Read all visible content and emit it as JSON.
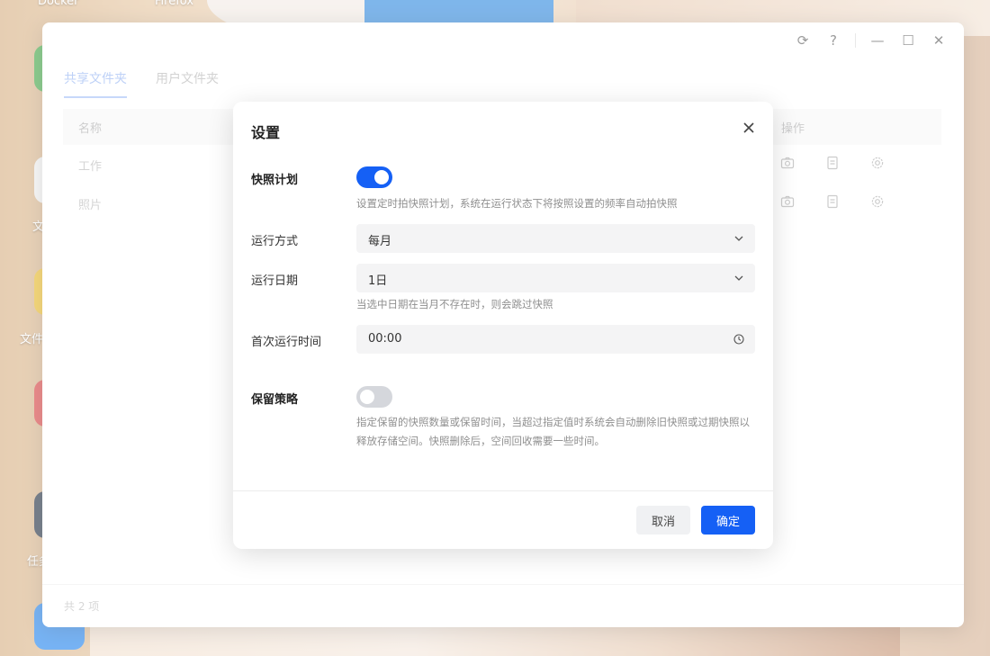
{
  "desktop": {
    "labels": [
      "Docker",
      "Firefox",
      "文",
      "文件",
      "任务"
    ]
  },
  "window": {
    "titlebar": {
      "refresh_glyph": "⟳",
      "help_glyph": "?",
      "minimize_glyph": "—",
      "maximize_glyph": "☐",
      "close_glyph": "✕"
    },
    "tabs": [
      {
        "label": "共享文件夹",
        "active": true
      },
      {
        "label": "用户文件夹",
        "active": false
      }
    ],
    "table": {
      "columns": [
        "名称",
        "操作"
      ],
      "rows": [
        {
          "name": "工作",
          "actions": [
            "camera-icon",
            "doc-icon",
            "gear-icon"
          ]
        },
        {
          "name": "照片",
          "actions": [
            "camera-icon",
            "doc-icon",
            "gear-icon"
          ]
        }
      ]
    },
    "footer": {
      "count_text": "共 2 项"
    }
  },
  "dialog": {
    "title": "设置",
    "snapshot_plan": {
      "label": "快照计划",
      "enabled": true,
      "hint": "设置定时拍快照计划，系统在运行状态下将按照设置的频率自动拍快照"
    },
    "run_mode": {
      "label": "运行方式",
      "value": "每月"
    },
    "run_date": {
      "label": "运行日期",
      "value": "1日",
      "hint": "当选中日期在当月不存在时，则会跳过快照"
    },
    "first_run_time": {
      "label": "首次运行时间",
      "value": "00:00"
    },
    "retention": {
      "label": "保留策略",
      "enabled": false,
      "hint": "指定保留的快照数量或保留时间，当超过指定值时系统会自动删除旧快照或过期快照以释放存储空间。快照删除后，空间回收需要一些时间。"
    },
    "buttons": {
      "cancel": "取消",
      "ok": "确定"
    }
  },
  "colors": {
    "accent": "#1560f5",
    "toggle_off": "#d5d7dc",
    "tab_active": "#9bb9f3"
  }
}
